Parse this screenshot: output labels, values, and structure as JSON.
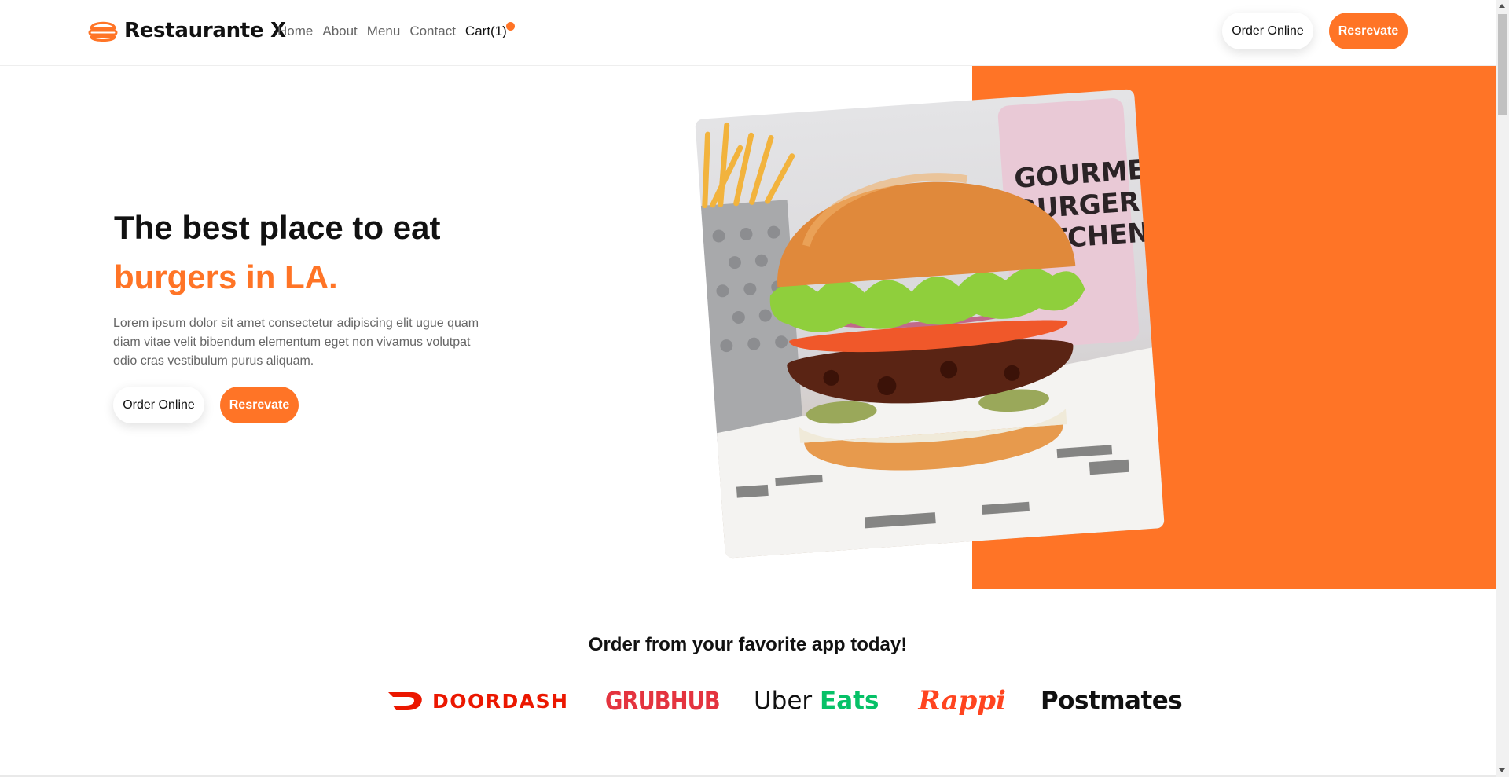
{
  "brand": {
    "name": "Restaurante X",
    "icon": "burger-icon"
  },
  "nav": {
    "links": [
      "Home",
      "About",
      "Menu",
      "Contact"
    ],
    "cart_label": "Cart(1)",
    "order_label": "Order Online",
    "reserve_label": "Resrevate"
  },
  "hero": {
    "title_line1": "The best place to eat",
    "title_line2": "burgers in LA.",
    "text": "Lorem ipsum dolor sit amet consectetur adipiscing elit ugue quam diam vitae velit bibendum elementum eget non vivamus volutpat odio cras vestibulum purus aliquam.",
    "order_label": "Order Online",
    "reserve_label": "Resrevate",
    "image": "burger-photo",
    "image_cup_text": [
      "GOURMET",
      "BURGER",
      "KITCHEN"
    ]
  },
  "apps": {
    "title": "Order from your favorite app today!",
    "doordash": "DOORDASH",
    "grubhub": "GRUBHUB",
    "uber": "Uber",
    "eats": "Eats",
    "rappi": "Rappi",
    "postmates": "Postmates"
  },
  "colors": {
    "accent": "#ff7426",
    "doordash": "#eb1700",
    "grubhub": "#e4343f",
    "ubereats": "#06c167",
    "rappi": "#ff441f"
  }
}
